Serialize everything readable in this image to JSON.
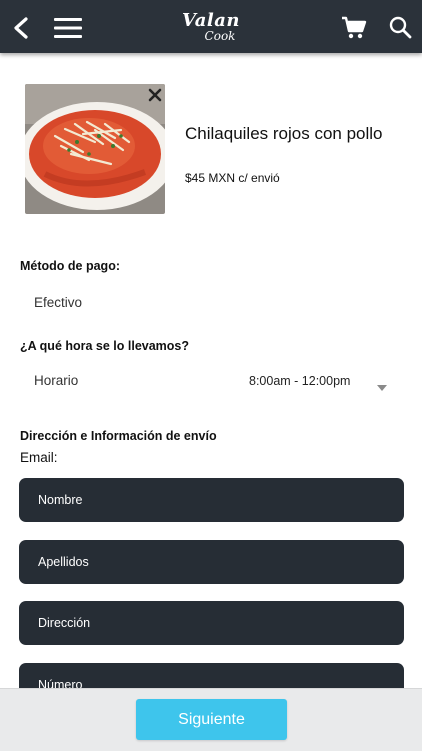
{
  "header": {
    "logo_line1": "Valan",
    "logo_line2": "Cook",
    "icons": [
      "back-arrow-icon",
      "hamburger-menu-icon",
      "cart-icon",
      "search-icon"
    ],
    "background_color": "#2b323a"
  },
  "product": {
    "name": "Chilaquiles rojos con pollo",
    "price": "$45 MXN c/ envió",
    "remove_icon": "close-icon"
  },
  "payment": {
    "label": "Método de pago:",
    "value": "Efectivo"
  },
  "delivery_time": {
    "label": "¿A qué hora se lo llevamos?",
    "field_label": "Horario",
    "selected": "8:00am - 12:00pm"
  },
  "shipping": {
    "section_label": "Dirección e Información de envío",
    "email_label": "Email:",
    "fields": [
      {
        "placeholder": "Nombre"
      },
      {
        "placeholder": "Apellidos"
      },
      {
        "placeholder": "Dirección"
      },
      {
        "placeholder": "Número"
      }
    ],
    "field_color": "#262d35"
  },
  "footer": {
    "next_label": "Siguiente",
    "accent_color": "#3ec5ec"
  }
}
